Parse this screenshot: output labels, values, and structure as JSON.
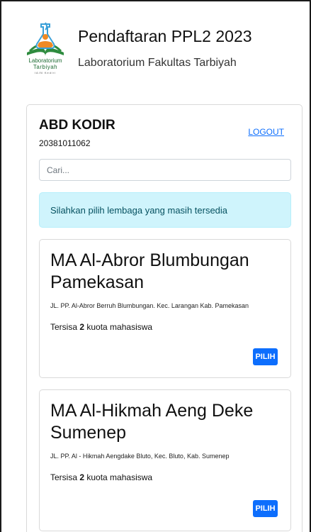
{
  "header": {
    "title": "Pendaftaran PPL2 2023",
    "subtitle": "Laboratorium Fakultas Tarbiyah",
    "logo_text_1": "Laboratorium",
    "logo_text_2": "Tarbiyah",
    "logo_text_3": "IAIN Kediri"
  },
  "user": {
    "name": "ABD KODIR",
    "id": "20381011062",
    "logout_label": "LOGOUT"
  },
  "search": {
    "placeholder": "Cari..."
  },
  "alert": {
    "text": "Silahkan pilih lembaga yang masih tersedia"
  },
  "options": [
    {
      "title": "MA Al-Abror Blumbungan Pamekasan",
      "address": "JL. PP. Al-Abror Berruh Blumbungan. Kec. Larangan Kab. Pamekasan",
      "quota_prefix": "Tersisa ",
      "quota_value": "2",
      "quota_suffix": " kuota mahasiswa",
      "button_label": "PILIH"
    },
    {
      "title": "MA Al-Hikmah Aeng Deke Sumenep",
      "address": "JL. PP. Al - Hikmah Aengdake Bluto, Kec. Bluto, Kab. Sumenep",
      "quota_prefix": "Tersisa ",
      "quota_value": "2",
      "quota_suffix": " kuota mahasiswa",
      "button_label": "PILIH"
    }
  ],
  "colors": {
    "accent": "#0d6efd",
    "alert_bg": "#cff4fc",
    "alert_text": "#055160",
    "logo_green": "#1d6b32",
    "logo_orange": "#f08a24",
    "logo_blue": "#3aa0d8"
  }
}
